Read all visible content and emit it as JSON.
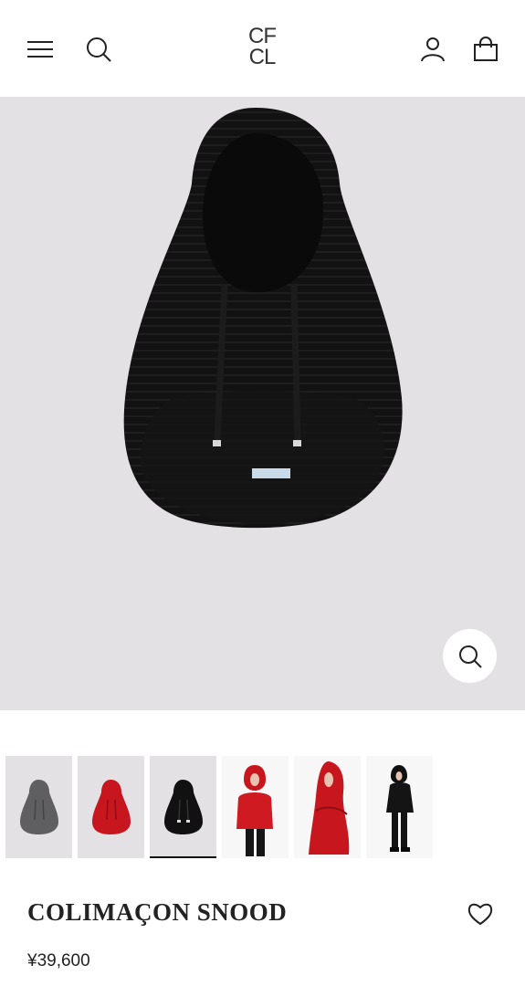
{
  "brand": {
    "logo_line1": "CF",
    "logo_line2": "CL"
  },
  "header": {
    "menu_icon": "menu-icon",
    "search_icon": "search-icon",
    "account_icon": "user-icon",
    "cart_icon": "shopping-bag-icon"
  },
  "gallery": {
    "selected_index": 2,
    "zoom_icon": "zoom-icon",
    "thumbnails": [
      {
        "variant": "grey snood"
      },
      {
        "variant": "red snood"
      },
      {
        "variant": "black snood"
      },
      {
        "variant": "red worn front"
      },
      {
        "variant": "red worn side"
      },
      {
        "variant": "black worn full"
      }
    ]
  },
  "product": {
    "title": "COLIMAÇON SNOOD",
    "price": "¥39,600",
    "favorite_icon": "heart-icon"
  },
  "colors": {
    "hero_bg": "#e3e1e3",
    "snood_black": "#111111",
    "snood_red": "#c8161e",
    "snood_grey": "#5f5f62"
  }
}
